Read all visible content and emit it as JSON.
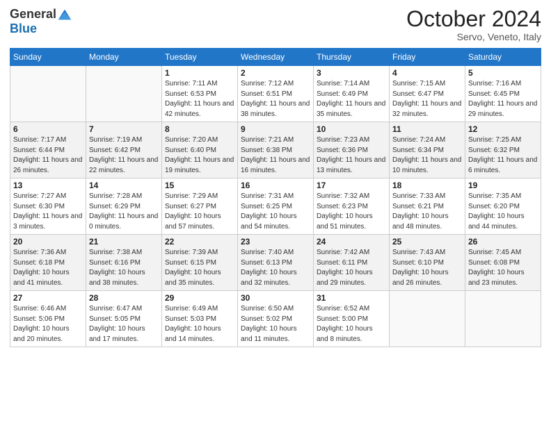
{
  "header": {
    "logo_general": "General",
    "logo_blue": "Blue",
    "month_title": "October 2024",
    "location": "Servo, Veneto, Italy"
  },
  "days_of_week": [
    "Sunday",
    "Monday",
    "Tuesday",
    "Wednesday",
    "Thursday",
    "Friday",
    "Saturday"
  ],
  "weeks": [
    [
      {
        "day": "",
        "info": ""
      },
      {
        "day": "",
        "info": ""
      },
      {
        "day": "1",
        "info": "Sunrise: 7:11 AM\nSunset: 6:53 PM\nDaylight: 11 hours and 42 minutes."
      },
      {
        "day": "2",
        "info": "Sunrise: 7:12 AM\nSunset: 6:51 PM\nDaylight: 11 hours and 38 minutes."
      },
      {
        "day": "3",
        "info": "Sunrise: 7:14 AM\nSunset: 6:49 PM\nDaylight: 11 hours and 35 minutes."
      },
      {
        "day": "4",
        "info": "Sunrise: 7:15 AM\nSunset: 6:47 PM\nDaylight: 11 hours and 32 minutes."
      },
      {
        "day": "5",
        "info": "Sunrise: 7:16 AM\nSunset: 6:45 PM\nDaylight: 11 hours and 29 minutes."
      }
    ],
    [
      {
        "day": "6",
        "info": "Sunrise: 7:17 AM\nSunset: 6:44 PM\nDaylight: 11 hours and 26 minutes."
      },
      {
        "day": "7",
        "info": "Sunrise: 7:19 AM\nSunset: 6:42 PM\nDaylight: 11 hours and 22 minutes."
      },
      {
        "day": "8",
        "info": "Sunrise: 7:20 AM\nSunset: 6:40 PM\nDaylight: 11 hours and 19 minutes."
      },
      {
        "day": "9",
        "info": "Sunrise: 7:21 AM\nSunset: 6:38 PM\nDaylight: 11 hours and 16 minutes."
      },
      {
        "day": "10",
        "info": "Sunrise: 7:23 AM\nSunset: 6:36 PM\nDaylight: 11 hours and 13 minutes."
      },
      {
        "day": "11",
        "info": "Sunrise: 7:24 AM\nSunset: 6:34 PM\nDaylight: 11 hours and 10 minutes."
      },
      {
        "day": "12",
        "info": "Sunrise: 7:25 AM\nSunset: 6:32 PM\nDaylight: 11 hours and 6 minutes."
      }
    ],
    [
      {
        "day": "13",
        "info": "Sunrise: 7:27 AM\nSunset: 6:30 PM\nDaylight: 11 hours and 3 minutes."
      },
      {
        "day": "14",
        "info": "Sunrise: 7:28 AM\nSunset: 6:29 PM\nDaylight: 11 hours and 0 minutes."
      },
      {
        "day": "15",
        "info": "Sunrise: 7:29 AM\nSunset: 6:27 PM\nDaylight: 10 hours and 57 minutes."
      },
      {
        "day": "16",
        "info": "Sunrise: 7:31 AM\nSunset: 6:25 PM\nDaylight: 10 hours and 54 minutes."
      },
      {
        "day": "17",
        "info": "Sunrise: 7:32 AM\nSunset: 6:23 PM\nDaylight: 10 hours and 51 minutes."
      },
      {
        "day": "18",
        "info": "Sunrise: 7:33 AM\nSunset: 6:21 PM\nDaylight: 10 hours and 48 minutes."
      },
      {
        "day": "19",
        "info": "Sunrise: 7:35 AM\nSunset: 6:20 PM\nDaylight: 10 hours and 44 minutes."
      }
    ],
    [
      {
        "day": "20",
        "info": "Sunrise: 7:36 AM\nSunset: 6:18 PM\nDaylight: 10 hours and 41 minutes."
      },
      {
        "day": "21",
        "info": "Sunrise: 7:38 AM\nSunset: 6:16 PM\nDaylight: 10 hours and 38 minutes."
      },
      {
        "day": "22",
        "info": "Sunrise: 7:39 AM\nSunset: 6:15 PM\nDaylight: 10 hours and 35 minutes."
      },
      {
        "day": "23",
        "info": "Sunrise: 7:40 AM\nSunset: 6:13 PM\nDaylight: 10 hours and 32 minutes."
      },
      {
        "day": "24",
        "info": "Sunrise: 7:42 AM\nSunset: 6:11 PM\nDaylight: 10 hours and 29 minutes."
      },
      {
        "day": "25",
        "info": "Sunrise: 7:43 AM\nSunset: 6:10 PM\nDaylight: 10 hours and 26 minutes."
      },
      {
        "day": "26",
        "info": "Sunrise: 7:45 AM\nSunset: 6:08 PM\nDaylight: 10 hours and 23 minutes."
      }
    ],
    [
      {
        "day": "27",
        "info": "Sunrise: 6:46 AM\nSunset: 5:06 PM\nDaylight: 10 hours and 20 minutes."
      },
      {
        "day": "28",
        "info": "Sunrise: 6:47 AM\nSunset: 5:05 PM\nDaylight: 10 hours and 17 minutes."
      },
      {
        "day": "29",
        "info": "Sunrise: 6:49 AM\nSunset: 5:03 PM\nDaylight: 10 hours and 14 minutes."
      },
      {
        "day": "30",
        "info": "Sunrise: 6:50 AM\nSunset: 5:02 PM\nDaylight: 10 hours and 11 minutes."
      },
      {
        "day": "31",
        "info": "Sunrise: 6:52 AM\nSunset: 5:00 PM\nDaylight: 10 hours and 8 minutes."
      },
      {
        "day": "",
        "info": ""
      },
      {
        "day": "",
        "info": ""
      }
    ]
  ]
}
